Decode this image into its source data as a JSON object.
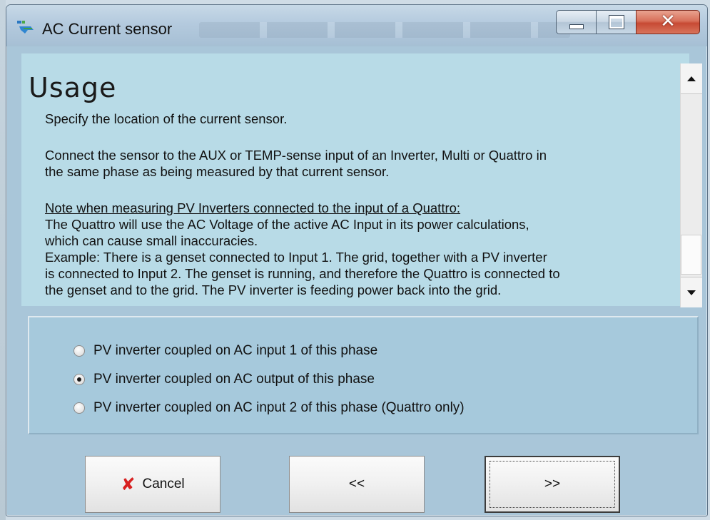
{
  "window": {
    "title": "AC Current sensor",
    "icon": "victron-app-icon",
    "controls": {
      "minimize": "minimize-icon",
      "maximize": "maximize-icon",
      "close": "✕"
    }
  },
  "usage": {
    "heading": "Usage",
    "lines": [
      "Specify the location of the current sensor.",
      "Connect the sensor to the AUX or TEMP-sense input of an Inverter, Multi or Quattro in",
      "the same phase as being measured by that current sensor.",
      "Note when measuring PV Inverters connected to the input of a Quattro:",
      "The Quattro will use the AC Voltage of the active AC Input in its power calculations,",
      "which can cause small inaccuracies.",
      "Example: There is a genset connected to Input 1. The grid, together with a PV inverter",
      "is connected to Input 2. The genset is running, and therefore the Quattro is connected to",
      "the genset and to the grid. The PV inverter is feeding power back into the grid."
    ]
  },
  "options": [
    {
      "label": "PV inverter coupled on AC input 1 of this phase",
      "selected": false
    },
    {
      "label": "PV inverter coupled on AC output of this phase",
      "selected": true
    },
    {
      "label": "PV inverter coupled on AC input 2 of this phase (Quattro only)",
      "selected": false
    }
  ],
  "buttons": {
    "cancel": "Cancel",
    "back": "<<",
    "next": ">>"
  },
  "colors": {
    "window_bg": "#a9c6d9",
    "content_bg": "#b8dbe7",
    "cancel_icon": "#d82020",
    "close_button": "#c74a34"
  }
}
